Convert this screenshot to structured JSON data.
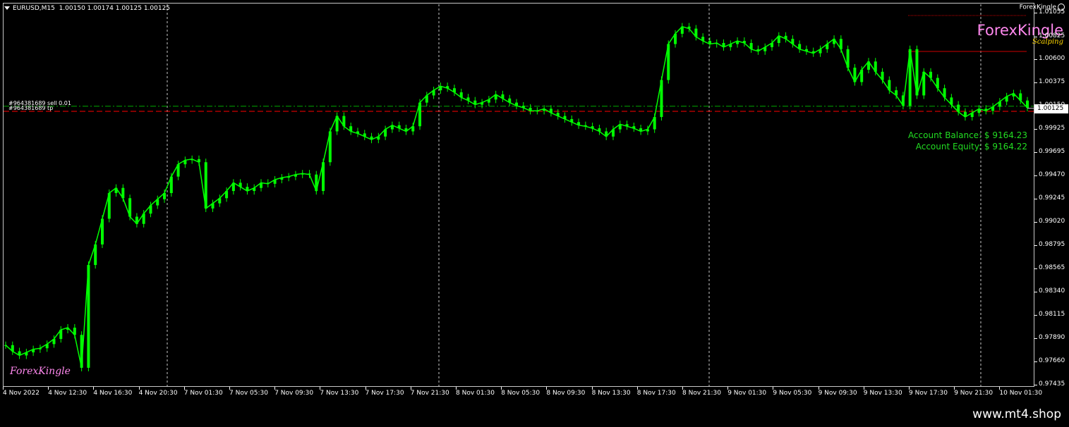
{
  "header": {
    "symbol": "EURUSD,M15",
    "ohlc": "1.00150 1.00174 1.00125 1.00125"
  },
  "corner_brand": "ForexKingle",
  "logo": {
    "title": "ForexKingle",
    "subtitle": "Scalping"
  },
  "watermark": "ForexKingle",
  "account": {
    "balance": "Account Balance: $ 9164.23",
    "equity": "Account Equity: $ 9164.22"
  },
  "orders": {
    "sell_label": "#964381689 sell 0.01",
    "tp_label": "#964381689 tp"
  },
  "current_price": "1.00125",
  "footer": {
    "url": "www.mt4.shop"
  },
  "colors": {
    "background": "#000000",
    "candle": "#00ff00",
    "order_line": "#00aa00",
    "tp_line": "#ff0000",
    "logo_pink": "#ff88ee",
    "account_green": "#22dd22"
  },
  "chart_data": {
    "type": "line",
    "symbol": "EURUSD",
    "timeframe": "M15",
    "price_axis_ticks": [
      "1.01055",
      "1.00825",
      "1.00600",
      "1.00375",
      "1.00150",
      "0.99925",
      "0.99695",
      "0.99470",
      "0.99245",
      "0.99020",
      "0.98795",
      "0.98565",
      "0.98340",
      "0.98115",
      "0.97890",
      "0.97660",
      "0.97435"
    ],
    "time_axis_ticks": [
      "4 Nov 2022",
      "4 Nov 12:30",
      "4 Nov 16:30",
      "4 Nov 20:30",
      "7 Nov 01:30",
      "7 Nov 05:30",
      "7 Nov 09:30",
      "7 Nov 13:30",
      "7 Nov 17:30",
      "7 Nov 21:30",
      "8 Nov 01:30",
      "8 Nov 05:30",
      "8 Nov 09:30",
      "8 Nov 13:30",
      "8 Nov 17:30",
      "8 Nov 21:30",
      "9 Nov 01:30",
      "9 Nov 05:30",
      "9 Nov 09:30",
      "9 Nov 13:30",
      "9 Nov 17:30",
      "9 Nov 21:30",
      "10 Nov 01:30"
    ],
    "ylim": [
      0.97435,
      1.01055
    ],
    "series": [
      {
        "values": [
          0.9782,
          0.9776,
          0.9772,
          0.9775,
          0.9778,
          0.9779,
          0.9783,
          0.9788,
          0.9797,
          0.9799,
          0.9792,
          0.976,
          0.986,
          0.988,
          0.9905,
          0.993,
          0.9935,
          0.9925,
          0.9907,
          0.99,
          0.991,
          0.9918,
          0.9924,
          0.993,
          0.9946,
          0.9958,
          0.9962,
          0.9963,
          0.996,
          0.9915,
          0.992,
          0.9925,
          0.9932,
          0.994,
          0.9936,
          0.9932,
          0.9935,
          0.994,
          0.9939,
          0.9943,
          0.9945,
          0.9946,
          0.9948,
          0.9949,
          0.9948,
          0.9932,
          0.996,
          0.999,
          1.0005,
          0.9995,
          0.999,
          0.9988,
          0.9985,
          0.9982,
          0.9985,
          0.9992,
          0.9996,
          0.9993,
          0.999,
          0.9995,
          1.0018,
          1.0025,
          1.003,
          1.0034,
          1.0032,
          1.0028,
          1.0023,
          1.002,
          1.0016,
          1.0018,
          1.0021,
          1.0026,
          1.0022,
          1.0018,
          1.0015,
          1.0013,
          1.001,
          1.001,
          1.0012,
          1.0008,
          1.0005,
          1.0002,
          0.9999,
          0.9996,
          0.9995,
          0.9993,
          0.999,
          0.9985,
          0.9992,
          0.9997,
          0.9995,
          0.9993,
          0.999,
          0.9992,
          1.0004,
          1.004,
          1.0075,
          1.0085,
          1.0092,
          1.009,
          1.0082,
          1.0078,
          1.0075,
          1.0076,
          1.0072,
          1.0075,
          1.0078,
          1.0076,
          1.007,
          1.0068,
          1.0072,
          1.0076,
          1.0083,
          1.008,
          1.0075,
          1.007,
          1.0068,
          1.0066,
          1.007,
          1.0075,
          1.008,
          1.007,
          1.0052,
          1.0038,
          1.005,
          1.0058,
          1.0048,
          1.004,
          1.003,
          1.0025,
          1.0015,
          1.007,
          1.0025,
          1.0048,
          1.0042,
          1.0032,
          1.0023,
          1.0016,
          1.0009,
          1.0004,
          1.0008,
          1.0012,
          1.001,
          1.0014,
          1.0019,
          1.0024,
          1.0027,
          1.002,
          1.0013
        ]
      }
    ],
    "order_levels": {
      "sell": 1.00145,
      "tp": 1.00095
    }
  }
}
